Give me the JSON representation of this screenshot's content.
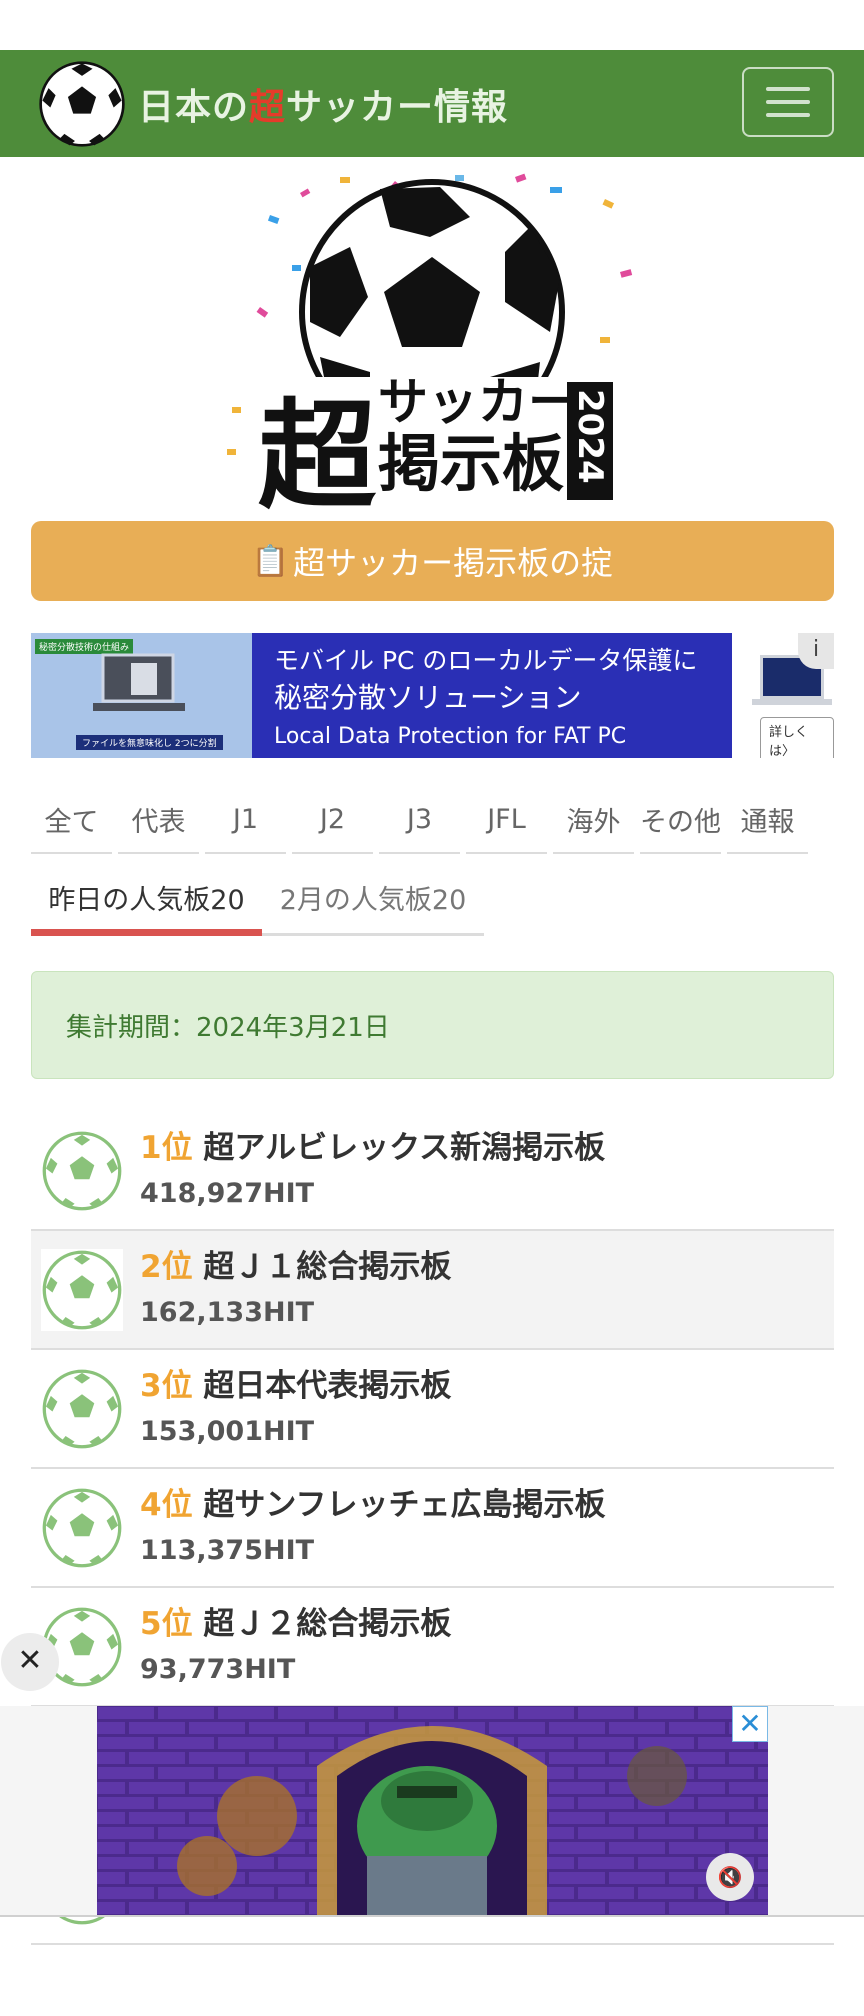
{
  "header": {
    "title_pre": "日本の",
    "title_hl": "超",
    "title_post": "サッカー情報",
    "brand_color": "#4e8c3a",
    "highlight_color": "#e53b2a",
    "menu_icon": "hamburger-icon"
  },
  "logo": {
    "big_char": "超",
    "line1": "サッカー",
    "line2": "掲示板",
    "year": "2024"
  },
  "rules_button": {
    "icon": "📋",
    "label": "超サッカー掲示板の掟",
    "color": "#e8ae56"
  },
  "top_ad": {
    "tag": "秘密分散技術の仕組み",
    "caption": "ファイルを無意味化し 2つに分割",
    "line1": "モバイル PC のローカルデータ保護に",
    "line2": "秘密分散ソリューション",
    "line3": "Local Data Protection for FAT PC",
    "more": "詳しくは〉",
    "info": "i"
  },
  "category_tabs": [
    "全て",
    "代表",
    "J1",
    "J2",
    "J3",
    "JFL",
    "海外",
    "その他",
    "通報"
  ],
  "ranking_tabs": {
    "active": "昨日の人気板20",
    "inactive": "2月の人気板20"
  },
  "period": {
    "label": "集計期間：",
    "value": "2024年3月21日"
  },
  "rankings": [
    {
      "pos": "1位",
      "name": "超アルビレックス新潟掲示板",
      "hits": "418,927HIT"
    },
    {
      "pos": "2位",
      "name": "超Ｊ１総合掲示板",
      "hits": "162,133HIT"
    },
    {
      "pos": "3位",
      "name": "超日本代表掲示板",
      "hits": "153,001HIT"
    },
    {
      "pos": "4位",
      "name": "超サンフレッチェ広島掲示板",
      "hits": "113,375HIT"
    },
    {
      "pos": "5位",
      "name": "超Ｊ２総合掲示板",
      "hits": "93,773HIT"
    }
  ],
  "float_close": "✕",
  "bottom_ad": {
    "close": "✕",
    "mute": "🔇"
  }
}
